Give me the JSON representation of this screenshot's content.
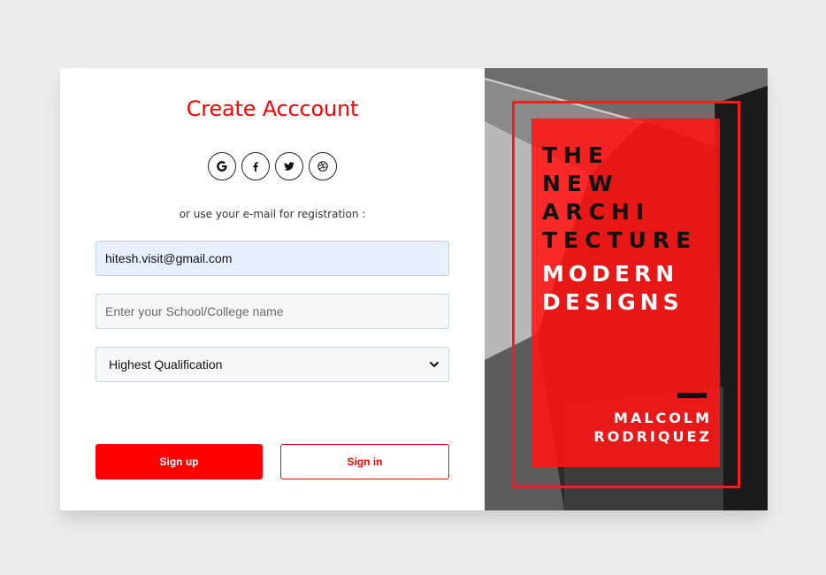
{
  "form": {
    "title": "Create Acccount",
    "social_icons": [
      "google-icon",
      "facebook-icon",
      "twitter-icon",
      "dribbble-icon"
    ],
    "hint": "or use your e-mail for registration :",
    "email_value": "hitesh.visit@gmail.com",
    "school_placeholder": "Enter your School/College name",
    "qualification_selected": "Highest Qualification",
    "signup_label": "Sign up",
    "signin_label": "Sign in"
  },
  "poster": {
    "heading_lines": [
      "THE",
      "NEW",
      "ARCHI",
      "TECTURE"
    ],
    "subheading_lines": [
      "MODERN",
      "DESIGNS"
    ],
    "author_lines": [
      "MALCOLM",
      "RODRIQUEZ"
    ]
  },
  "colors": {
    "accent": "#ff0000",
    "background": "#ededed",
    "email_autofill": "#e8f0fe"
  }
}
